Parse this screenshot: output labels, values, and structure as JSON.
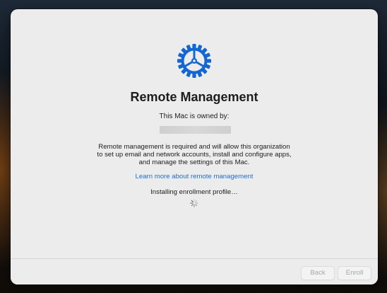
{
  "header": {
    "title": "Remote Management",
    "owned_by_label": "This Mac is owned by:"
  },
  "main": {
    "description": "Remote management is required and will allow this organization to set up email and network accounts, install and configure apps, and manage the settings of this Mac.",
    "learn_more_link": "Learn more about remote management",
    "status_text": "Installing enrollment profile…"
  },
  "footer": {
    "back_label": "Back",
    "enroll_label": "Enroll"
  },
  "colors": {
    "accent": "#1a6fd4",
    "gear": "#1466d2"
  },
  "icons": {
    "gear": "gear-icon",
    "spinner": "progress-spinner-icon"
  }
}
